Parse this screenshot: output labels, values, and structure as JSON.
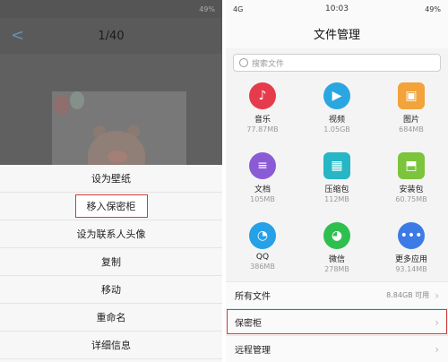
{
  "left": {
    "status": {
      "carrier": "",
      "center": "",
      "battery": "49%"
    },
    "header": {
      "back_label": "<",
      "title": "1/40"
    },
    "menu": [
      {
        "label": "设为壁纸"
      },
      {
        "label": "移入保密柜",
        "highlighted": true
      },
      {
        "label": "设为联系人头像"
      },
      {
        "label": "复制"
      },
      {
        "label": "移动"
      },
      {
        "label": "重命名"
      },
      {
        "label": "详细信息"
      }
    ]
  },
  "right": {
    "status": {
      "carrier": "4G",
      "time": "10:03",
      "battery": "49%"
    },
    "title": "文件管理",
    "search_placeholder": "搜索文件",
    "categories": [
      {
        "name": "音乐",
        "size": "77.87MB",
        "icon": "music-icon",
        "color": "#e63b4d"
      },
      {
        "name": "视频",
        "size": "1.05GB",
        "icon": "video-icon",
        "color": "#2aa7e0"
      },
      {
        "name": "图片",
        "size": "684MB",
        "icon": "image-icon",
        "color": "#f2a33a"
      },
      {
        "name": "文档",
        "size": "105MB",
        "icon": "document-icon",
        "color": "#8b5bd6"
      },
      {
        "name": "压缩包",
        "size": "112MB",
        "icon": "archive-icon",
        "color": "#26b6c5"
      },
      {
        "name": "安装包",
        "size": "60.75MB",
        "icon": "android-package-icon",
        "color": "#7cc43c"
      },
      {
        "name": "QQ",
        "size": "386MB",
        "icon": "qq-icon",
        "color": "#26a0e6"
      },
      {
        "name": "微信",
        "size": "278MB",
        "icon": "wechat-icon",
        "color": "#2fbf4f"
      },
      {
        "name": "更多应用",
        "size": "93.14MB",
        "icon": "more-apps-icon",
        "color": "#3c7be6"
      }
    ],
    "rows": [
      {
        "label": "所有文件",
        "meta": "8.84GB 可用"
      },
      {
        "label": "保密柜",
        "meta": "",
        "highlighted": true
      },
      {
        "label": "远程管理",
        "meta": ""
      }
    ]
  }
}
